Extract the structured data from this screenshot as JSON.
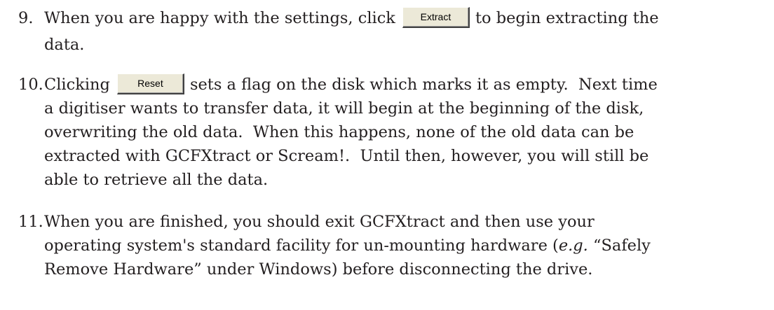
{
  "steps": [
    {
      "number": "9.",
      "line1_before": "When you are happy with the settings, click",
      "button_label": "Extract",
      "line1_after": "to begin extracting the",
      "line2": "data."
    },
    {
      "number": "10.",
      "line1_before": "Clicking",
      "button_label": "Reset",
      "line1_after": "sets a flag on the disk which marks it as empty.  Next time",
      "line2": "a digitiser wants to transfer data, it will begin at the beginning of the disk,",
      "line3": "overwriting the old data.  When this happens, none of the old data can be",
      "line4": "extracted with GCFXtract or Scream!.  Until then, however, you will still be",
      "line5": "able to retrieve all the data."
    },
    {
      "number": "11.",
      "line1": "When you are finished, you should exit GCFXtract and then use your",
      "line2_before": "operating system's standard facility for un-mounting hardware (",
      "line2_em": "e.g.",
      "line2_after": " “Safely",
      "line3": "Remove Hardware” under Windows) before disconnecting the drive."
    }
  ]
}
